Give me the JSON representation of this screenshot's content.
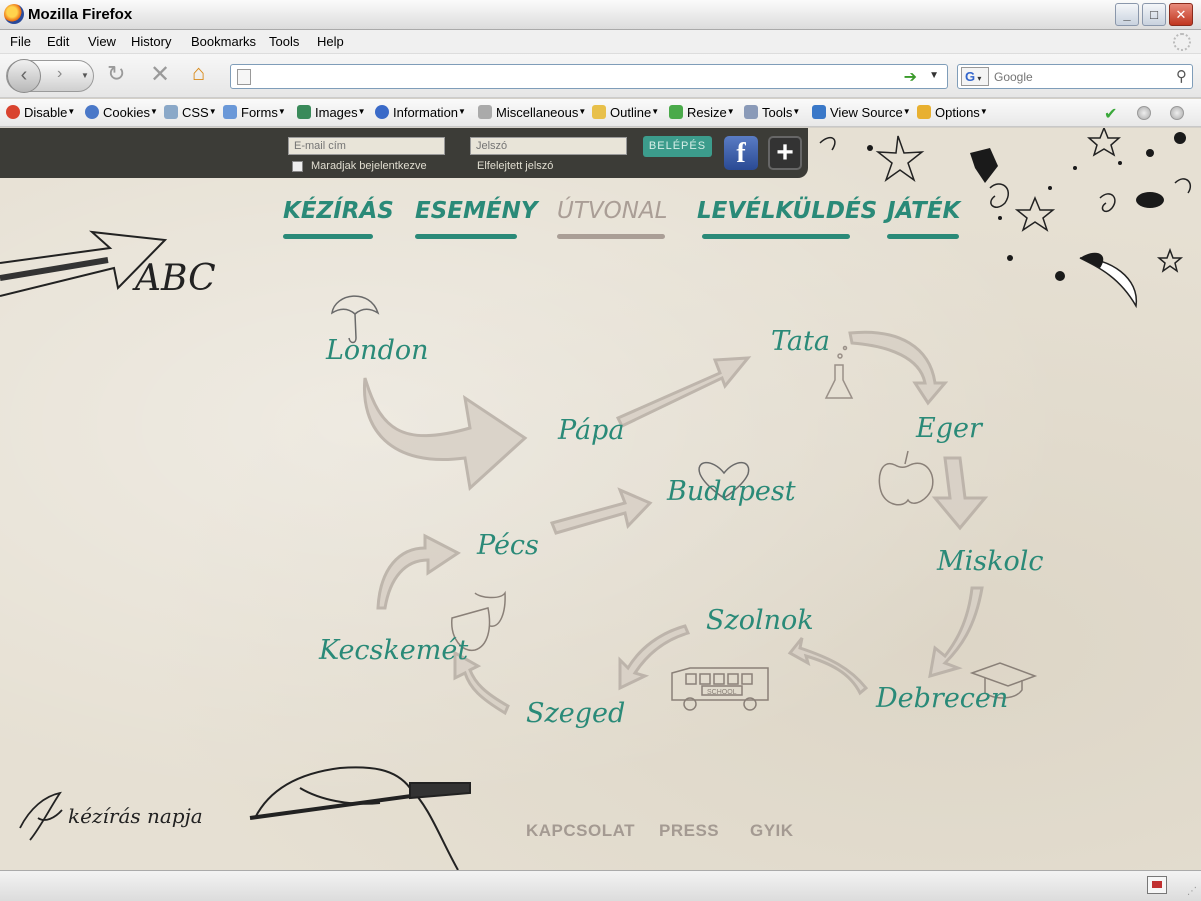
{
  "window": {
    "title": "Mozilla Firefox"
  },
  "menubar": [
    "File",
    "Edit",
    "View",
    "History",
    "Bookmarks",
    "Tools",
    "Help"
  ],
  "navbar": {
    "url_value": "",
    "search_placeholder": "Google",
    "search_engine": "G"
  },
  "devbar": {
    "items": [
      "Disable",
      "Cookies",
      "CSS",
      "Forms",
      "Images",
      "Information",
      "Miscellaneous",
      "Outline",
      "Resize",
      "Tools",
      "View Source",
      "Options"
    ]
  },
  "login": {
    "email_placeholder": "E-mail cím",
    "password_placeholder": "Jelszó",
    "login_button": "BELÉPÉS",
    "remember_label": "Maradjak bejelentkezve",
    "forgot_label": "Elfelejtett jelszó",
    "facebook": "f",
    "plus": "+"
  },
  "nav": [
    {
      "label": "KÉZÍRÁS",
      "active": false
    },
    {
      "label": "ESEMÉNY",
      "active": false
    },
    {
      "label": "ÚTVONAL",
      "active": true
    },
    {
      "label": "LEVÉLKÜLDÉS",
      "active": false
    },
    {
      "label": "JÁTÉK",
      "active": false
    }
  ],
  "logo_text": "ABC",
  "cities": [
    "London",
    "Pápa",
    "Tata",
    "Eger",
    "Budapest",
    "Pécs",
    "Miskolc",
    "Szolnok",
    "Kecskemét",
    "Szeged",
    "Debrecen"
  ],
  "bus_sign": "SCHOOL",
  "signature": "kézírás napja",
  "footer": [
    "KAPCSOLAT",
    "PRESS",
    "GYIK"
  ],
  "colors": {
    "accent": "#2a8a78",
    "inactive": "#aa9e96",
    "loginbar": "#3c3c37",
    "background": "#e6e0d3"
  }
}
